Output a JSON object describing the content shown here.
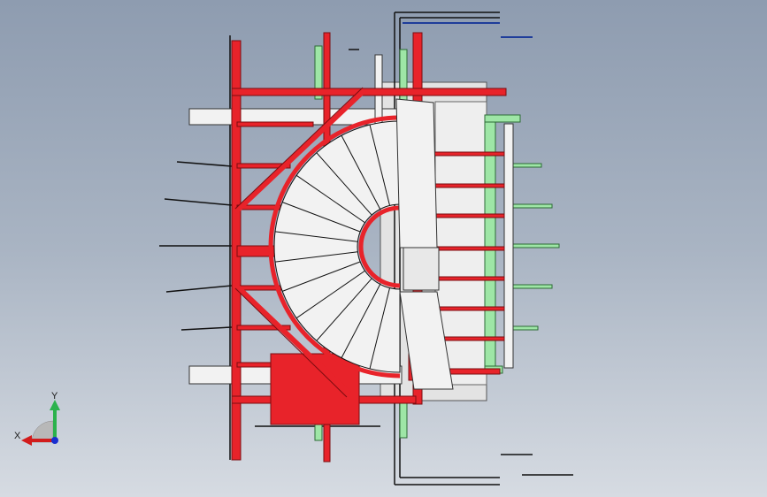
{
  "viewport": {
    "background_top": "#8e9cb0",
    "background_bottom": "#d6dbe2"
  },
  "model": {
    "frame_color": "#e8232a",
    "frame_edge": "#7a0c10",
    "rail_color": "#9ee6a6",
    "tread_color": "#f2f2f2",
    "panel_color": "#e3e3e3",
    "line_color": "#111111",
    "accent_blue": "#1f3d9a",
    "tread_count": 13
  },
  "triad": {
    "x_label": "X",
    "y_label": "Y",
    "x_color": "#d21c1c",
    "y_color": "#2bb24c",
    "z_color": "#1a2fd0"
  }
}
